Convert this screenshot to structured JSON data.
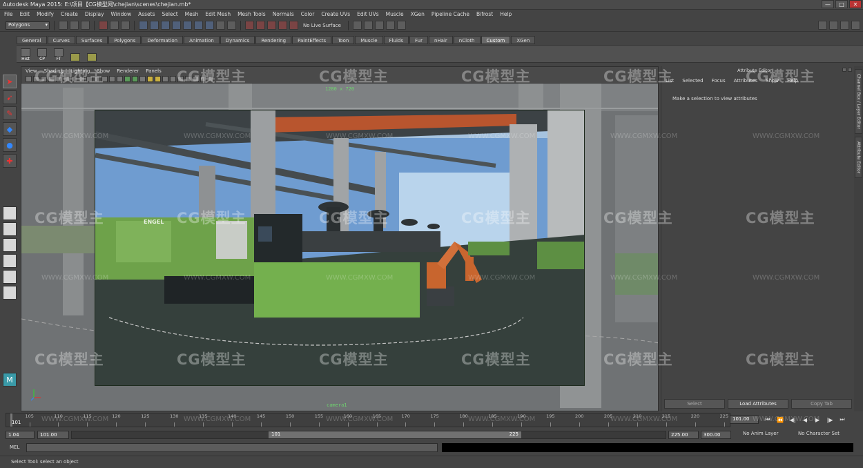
{
  "window": {
    "title": "Autodesk Maya 2015: E:\\项目【CG模型网\\chejian\\scenes\\chejian.mb*",
    "buttons": [
      "—",
      "□",
      "✕"
    ]
  },
  "menubar": [
    "File",
    "Edit",
    "Modify",
    "Create",
    "Display",
    "Window",
    "Assets",
    "Select",
    "Mesh",
    "Edit Mesh",
    "Mesh Tools",
    "Normals",
    "Color",
    "Create UVs",
    "Edit UVs",
    "Muscle",
    "XGen",
    "Pipeline Cache",
    "Bifrost",
    "Help"
  ],
  "statusline": {
    "mode": "Polygons",
    "live_surface": "No Live Surface"
  },
  "shelf": {
    "tabs": [
      "General",
      "Curves",
      "Surfaces",
      "Polygons",
      "Deformation",
      "Animation",
      "Dynamics",
      "Rendering",
      "PaintEffects",
      "Toon",
      "Muscle",
      "Fluids",
      "Fur",
      "nHair",
      "nCloth",
      "Custom",
      "XGen"
    ],
    "active_tab": "Custom",
    "buttons": [
      "Hist",
      "CP",
      "FT",
      "",
      ""
    ]
  },
  "viewport": {
    "menu": [
      "View",
      "Shading",
      "Lighting",
      "Show",
      "Renderer",
      "Panels"
    ],
    "resolution_gate": "1280 x 720",
    "camera": "camera1",
    "scene_text": "ENGEL"
  },
  "attribute_editor": {
    "title": "Attribute Editor",
    "menu": [
      "List",
      "Selected",
      "Focus",
      "Attributes",
      "Show",
      "Help"
    ],
    "hint": "Make a selection to view attributes",
    "buttons": [
      "Select",
      "Load Attributes",
      "Copy Tab"
    ]
  },
  "side_tabs": [
    "Channel Box / Layer Editor",
    "Attribute Editor"
  ],
  "timeline": {
    "tick_labels": [
      "101",
      "105",
      "110",
      "115",
      "120",
      "125",
      "130",
      "135",
      "140",
      "145",
      "150",
      "155",
      "160",
      "165",
      "170",
      "175",
      "180",
      "185",
      "190",
      "195",
      "200",
      "205",
      "210",
      "215",
      "220",
      "225"
    ],
    "current_frame": "101.00"
  },
  "range": {
    "start": "1.04",
    "playback_start": "101.00",
    "thumb_start": "101",
    "thumb_end": "225",
    "playback_end": "225.00",
    "end": "300.00",
    "anim_layer": "No Anim Layer",
    "character_set": "No Character Set"
  },
  "mel_label": "MEL",
  "help_line": "Select Tool: select an object",
  "watermarks": {
    "logo": "CG模型主",
    "url": "WWW.CGMXW.COM"
  }
}
